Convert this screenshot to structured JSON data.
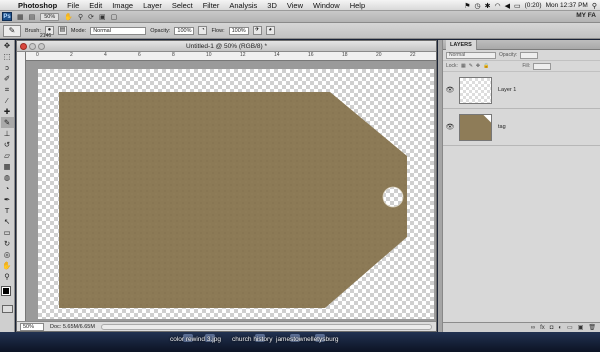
{
  "menubar": {
    "app_name": "Photoshop",
    "items": [
      "File",
      "Edit",
      "Image",
      "Layer",
      "Select",
      "Filter",
      "Analysis",
      "3D",
      "View",
      "Window",
      "Help"
    ],
    "status": {
      "battery": "(0:20)",
      "clock": "Mon 12:37 PM"
    }
  },
  "appbar": {
    "logo": "Ps",
    "zoom": "50%",
    "workspace": "MY FA"
  },
  "options": {
    "brush_label": "Brush:",
    "brush_size": "2146",
    "mode_label": "Mode:",
    "mode_value": "Normal",
    "opacity_label": "Opacity:",
    "opacity_value": "100%",
    "flow_label": "Flow:",
    "flow_value": "100%"
  },
  "document": {
    "title": "Untitled-1 @ 50% (RGB/8) *",
    "zoom": "50%",
    "doc_info": "Doc: 5.65M/6.65M",
    "ruler_marks": [
      "0",
      "2",
      "4",
      "6",
      "8",
      "10",
      "12",
      "14",
      "16",
      "18",
      "20",
      "22"
    ],
    "tag_color": "#8c7a56"
  },
  "layers_panel": {
    "tab_label": "LAYERS",
    "blend_mode": "Normal",
    "opacity_label": "Opacity:",
    "lock_label": "Lock:",
    "fill_label": "Fill:",
    "layers": [
      {
        "name": "Layer 1"
      },
      {
        "name": "tag"
      }
    ]
  },
  "dock": {
    "labels": [
      "color rewind 3.jpg",
      "church history",
      "jamestownelletysburg"
    ]
  }
}
